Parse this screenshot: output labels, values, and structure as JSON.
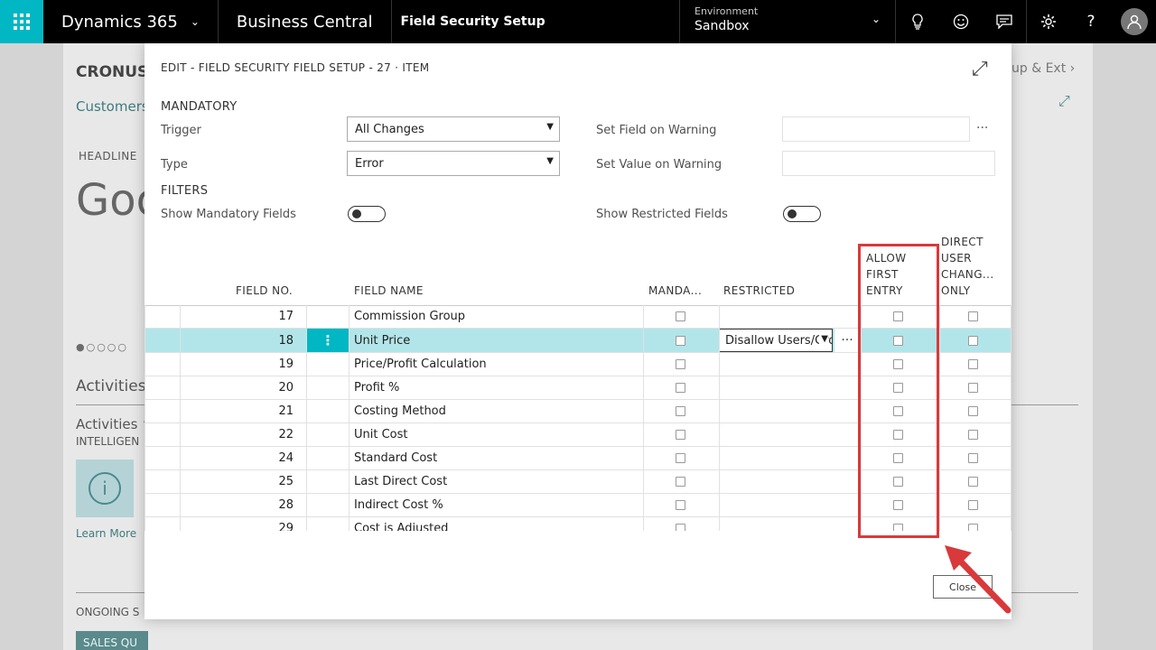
{
  "topbar": {
    "brand": "Dynamics 365",
    "product": "Business Central",
    "page_title": "Field Security Setup",
    "environment_label": "Environment",
    "environment_value": "Sandbox"
  },
  "background": {
    "company": "CRONUS",
    "customers": "Customers",
    "headline": "HEADLINE",
    "greeting": "Goo",
    "activities": "Activities",
    "activities2": "Activities ∨",
    "intelligence": "INTELLIGEN",
    "learn_more": "Learn More",
    "ongoing": "ONGOING S",
    "sales_tile": "SALES QU",
    "setup": "up & Ext",
    "pager_dots": "●○○○○"
  },
  "dialog": {
    "title": "EDIT - FIELD SECURITY FIELD SETUP - 27 · ITEM",
    "mandatory_section": "MANDATORY",
    "trigger_label": "Trigger",
    "trigger_value": "All Changes",
    "type_label": "Type",
    "type_value": "Error",
    "set_field_label": "Set Field on Warning",
    "set_value_label": "Set Value on Warning",
    "filters_section": "FILTERS",
    "show_mandatory_label": "Show Mandatory Fields",
    "show_restricted_label": "Show Restricted Fields",
    "close_label": "Close"
  },
  "grid": {
    "headers": {
      "field_no": "FIELD NO.",
      "field_name": "FIELD NAME",
      "mandatory": "MANDA...",
      "restricted": "RESTRICTED",
      "allow_first_1": "ALLOW",
      "allow_first_2": "FIRST",
      "allow_first_3": "ENTRY",
      "direct_1": "DIRECT",
      "direct_2": "USER",
      "direct_3": "CHANG...",
      "direct_4": "ONLY"
    },
    "rows": [
      {
        "no": "17",
        "name": "Commission Group"
      },
      {
        "no": "18",
        "name": "Unit Price",
        "restricted": "Disallow Users/Group"
      },
      {
        "no": "19",
        "name": "Price/Profit Calculation"
      },
      {
        "no": "20",
        "name": "Profit %"
      },
      {
        "no": "21",
        "name": "Costing Method"
      },
      {
        "no": "22",
        "name": "Unit Cost"
      },
      {
        "no": "24",
        "name": "Standard Cost"
      },
      {
        "no": "25",
        "name": "Last Direct Cost"
      },
      {
        "no": "28",
        "name": "Indirect Cost %"
      },
      {
        "no": "29",
        "name": "Cost is Adjusted"
      }
    ]
  },
  "colors": {
    "accent": "#00b7c3",
    "selected_row": "#b2e5e9",
    "annotation": "#d9393b"
  }
}
